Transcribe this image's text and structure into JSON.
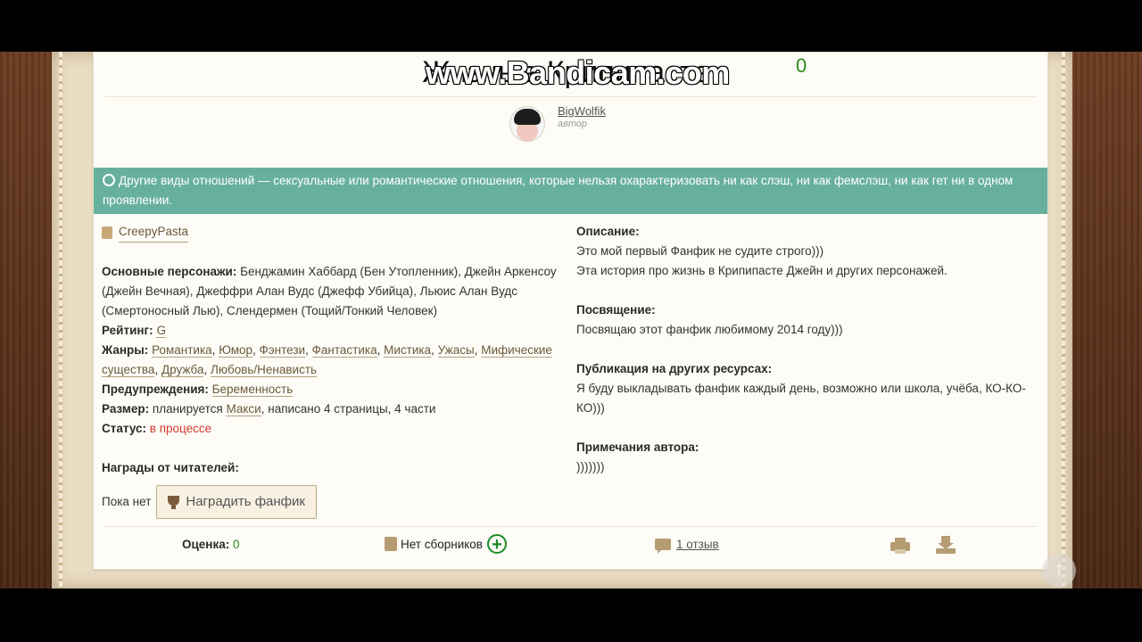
{
  "fanfic": {
    "title": "Жизнь в Крипипасте.",
    "likes": "0",
    "watermark": "www.Bandicam.com"
  },
  "author": {
    "name": "BigWolfik",
    "role": "автор"
  },
  "direction": {
    "text": "Другие виды отношений — сексуальные или романтические отношения, которые нельзя охарактеризовать ни как слэш, ни как фемслэш, ни как гет ни в одном проявлении."
  },
  "info": {
    "fandom": "CreepyPasta",
    "characters_label": "Основные персонажи:",
    "characters": "Бенджамин Хаббард (Бен Утопленник), Джейн Аркенсоу (Джейн Вечная), Джеффри Алан Вудс (Джефф Убийца), Льюис Алан Вудс (Смертоносный Лью), Слендермен (Тощий/Тонкий Человек)",
    "rating_label": "Рейтинг:",
    "rating": "G",
    "genres_label": "Жанры:",
    "genres": [
      "Романтика",
      "Юмор",
      "Фэнтези",
      "Фантастика",
      "Мистика",
      "Ужасы",
      "Мифические существа",
      "Дружба",
      "Любовь/Ненависть"
    ],
    "warnings_label": "Предупреждения:",
    "warning": "Беременность",
    "size_label": "Размер:",
    "size_prefix": "планируется",
    "size_value": "Макси",
    "size_suffix": ", написано 4 страницы, 4 части",
    "status_label": "Статус:",
    "status": "в процессе",
    "awards_label": "Награды от читателей:",
    "awards_none": "Пока нет",
    "award_button": "Наградить фанфик"
  },
  "details": {
    "description_label": "Описание:",
    "description_line1": "Это мой первый Фанфик не судите строго)))",
    "description_line2": "Эта история про жизнь в Крипипасте Джейн и других персонажей.",
    "dedication_label": "Посвящение:",
    "dedication": "Посвящаю этот фанфик любимому 2014 году)))",
    "publication_label": "Публикация на других ресурсах:",
    "publication": "Я буду выкладывать фанфик каждый день, возможно или школа, учёба, КО-КО-КО)))",
    "notes_label": "Примечания автора:",
    "notes": ")))))))"
  },
  "footer": {
    "rating_label": "Оценка:",
    "rating_value": "0",
    "collections": "Нет сборников",
    "reviews": "1 отзыв"
  },
  "colors": {
    "banner": "#68b09e",
    "likes": "#2b8a17",
    "status": "#d23b2e",
    "accent_green": "#1d8a2a"
  }
}
